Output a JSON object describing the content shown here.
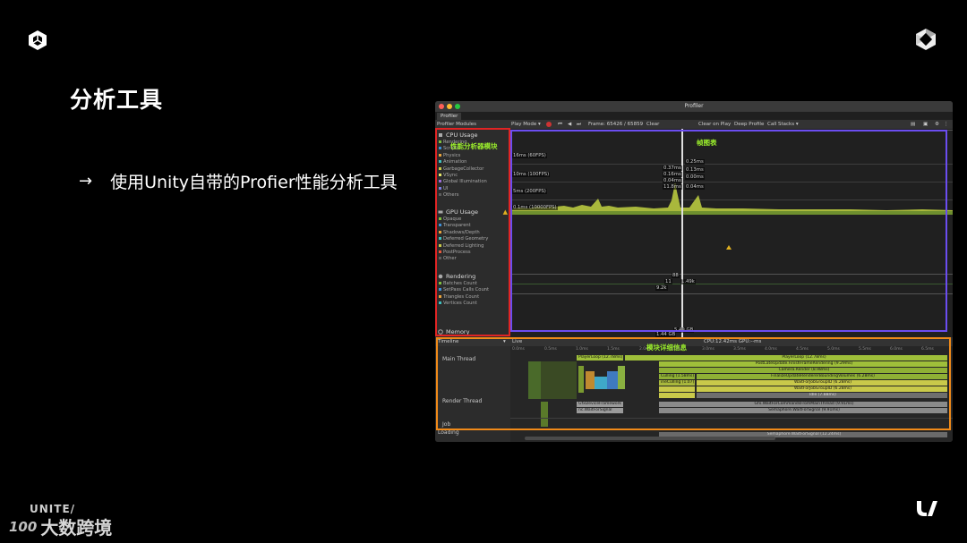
{
  "slide": {
    "title": "分析工具",
    "bullet_arrow": "→",
    "bullet": "使用Unity自带的Profier性能分析工具",
    "footer_event": "UNITE/",
    "footer_brand_mark": "100",
    "footer_brand": "大数跨境"
  },
  "window": {
    "title": "Profiler",
    "tab": "Profiler",
    "toolbar": {
      "modules": "Profiler Modules",
      "play_mode": "Play Mode ▾",
      "frame": "Frame: 65426 / 65859",
      "clear": "Clear",
      "clear_on_play": "Clear on Play",
      "deep_profile": "Deep Profile",
      "call_stacks": "Call Stacks ▾"
    },
    "modules": {
      "cpu": {
        "title": "CPU Usage",
        "items": [
          "Rendering",
          "Scripts",
          "Physics",
          "Animation",
          "GarbageCollector",
          "VSync",
          "Global Illumination",
          "UI",
          "Others"
        ],
        "colors": [
          "#7fbf3f",
          "#3f8fd6",
          "#e8a33d",
          "#3fbfbf",
          "#c9c94a",
          "#e8e86a",
          "#9b6cd6",
          "#7c7ce0",
          "#5e5e5e"
        ]
      },
      "gpu": {
        "title": "GPU Usage",
        "items": [
          "Opaque",
          "Transparent",
          "Shadows/Depth",
          "Deferred Geometry",
          "Deferred Lighting",
          "PostProcess",
          "Other"
        ],
        "colors": [
          "#7fbf3f",
          "#3f8fd6",
          "#e8a33d",
          "#3fbfbf",
          "#c9c94a",
          "#e85a3d",
          "#5e5e5e"
        ]
      },
      "rendering": {
        "title": "Rendering",
        "items": [
          "Batches Count",
          "SetPass Calls Count",
          "Triangles Count",
          "Vertices Count"
        ],
        "colors": [
          "#7fbf3f",
          "#3f8fd6",
          "#e8a33d",
          "#3fbfbf"
        ]
      },
      "memory": {
        "title": "Memory"
      }
    },
    "graph": {
      "fps_labels": [
        "16ms (60FPS)",
        "10ms (100FPS)",
        "5ms (200FPS)"
      ],
      "gpu_label": "0.1ms (10000FPS)",
      "values_left": [
        "0.37ms",
        "0.16ms",
        "0.04ms",
        "11.8ms"
      ],
      "values_right": [
        "0.25ms",
        "0.13ms",
        "0.00ms",
        "0.04ms"
      ],
      "render_values": [
        "88",
        "11",
        "1.49k",
        "9.2k"
      ],
      "memory_values": [
        "5.49 GB",
        "1.44 GB"
      ]
    },
    "timeline": {
      "view": "Timeline",
      "live": "Live",
      "cpu_summary": "CPU:12.42ms   GPU:--ms",
      "ticks": [
        "0.0ms",
        "0.5ms",
        "1.0ms",
        "1.5ms",
        "2.0ms",
        "2.5ms",
        "3.0ms",
        "3.5ms",
        "4.0ms",
        "4.5ms",
        "5.0ms",
        "5.5ms",
        "6.0ms",
        "6.5ms"
      ],
      "threads": [
        "Main Thread",
        "Render Thread",
        "Job",
        "Loading"
      ],
      "main_bars": [
        "PlayerLoop (12.78ms)",
        "PostLateUpdate.FinishFrameRendering (9.29ms)",
        "Camera.Render (8.98ms)",
        "Culling (1.58ms)",
        "FinalizeUpdateRendererBoundingVolumes (6.28ms)",
        "ineCulling (1.07)",
        "WaitForJobGroupID (6.28ms)",
        "WaitForJobGroupID (6.28ms)",
        "Idle (7.88ms)"
      ],
      "render_bars": [
        "GfxDeviceFramework",
        "nc.WaitForSignal",
        "Gfx.WaitForCommandsFromMainThread (9.91ms)",
        "Semaphore.WaitForSignal (9.91ms)"
      ],
      "loading_bar": "Semaphore.WaitForSignal (12.24ms)"
    }
  },
  "annotations": {
    "modules_label": "性能分析器模块",
    "chart_label": "帧图表",
    "details_label": "模块详细信息",
    "colors": {
      "modules": "#e02424",
      "chart": "#6b4df0",
      "details": "#f08a19",
      "text": "#9cf02c"
    }
  }
}
